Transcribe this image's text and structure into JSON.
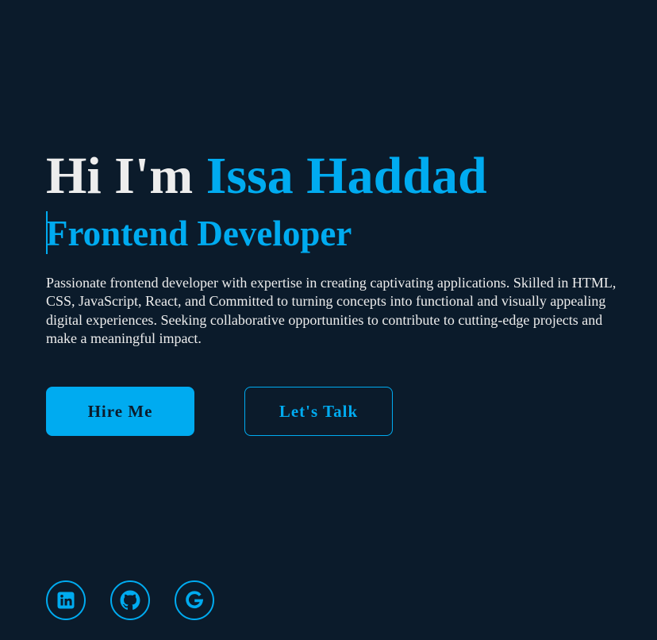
{
  "hero": {
    "greeting_prefix": "Hi I'm ",
    "name": "Issa Haddad",
    "role": "Frontend Developer",
    "bio": "Passionate frontend developer with expertise in creating captivating applications. Skilled in HTML, CSS, JavaScript, React, and Committed to turning concepts into functional and visually appealing digital experiences. Seeking collaborative opportunities to contribute to cutting-edge projects and make a meaningful impact."
  },
  "buttons": {
    "hire_label": "Hire Me",
    "talk_label": "Let's Talk"
  },
  "socials": [
    {
      "icon": "linkedin-icon"
    },
    {
      "icon": "github-icon"
    },
    {
      "icon": "google-icon"
    }
  ],
  "colors": {
    "background": "#0b1b2b",
    "accent": "#00abf0",
    "text": "#ededed"
  }
}
